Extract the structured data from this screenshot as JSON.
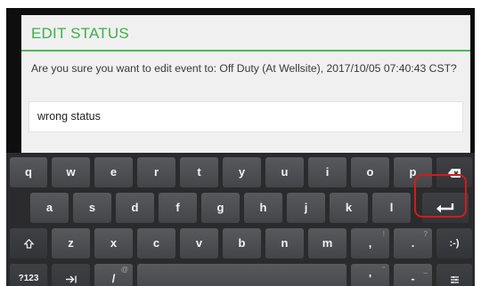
{
  "dialog": {
    "title": "EDIT STATUS",
    "message": "Are you sure you want to edit event to: Off Duty (At Wellsite), 2017/10/05 07:40:43 CST?",
    "reason_value": "wrong status"
  },
  "keyboard": {
    "row1": [
      "q",
      "w",
      "e",
      "r",
      "t",
      "y",
      "u",
      "i",
      "o",
      "p"
    ],
    "row2": [
      "a",
      "s",
      "d",
      "f",
      "g",
      "h",
      "j",
      "k",
      "l"
    ],
    "row3": [
      "z",
      "x",
      "c",
      "v",
      "b",
      "n",
      "m",
      ",",
      "."
    ],
    "smiley": ":-)",
    "symbols": "?123",
    "slash": "/",
    "apostrophe": "'",
    "dash": "-",
    "hints": {
      "slash": "@",
      "comma": "!",
      "period": "?",
      "apostrophe": "\"",
      "dash": "_"
    },
    "icons": {
      "backspace": "backspace-icon",
      "enter": "enter-icon",
      "shift": "shift-icon",
      "tab": "tab-icon",
      "settings": "settings-icon"
    }
  }
}
